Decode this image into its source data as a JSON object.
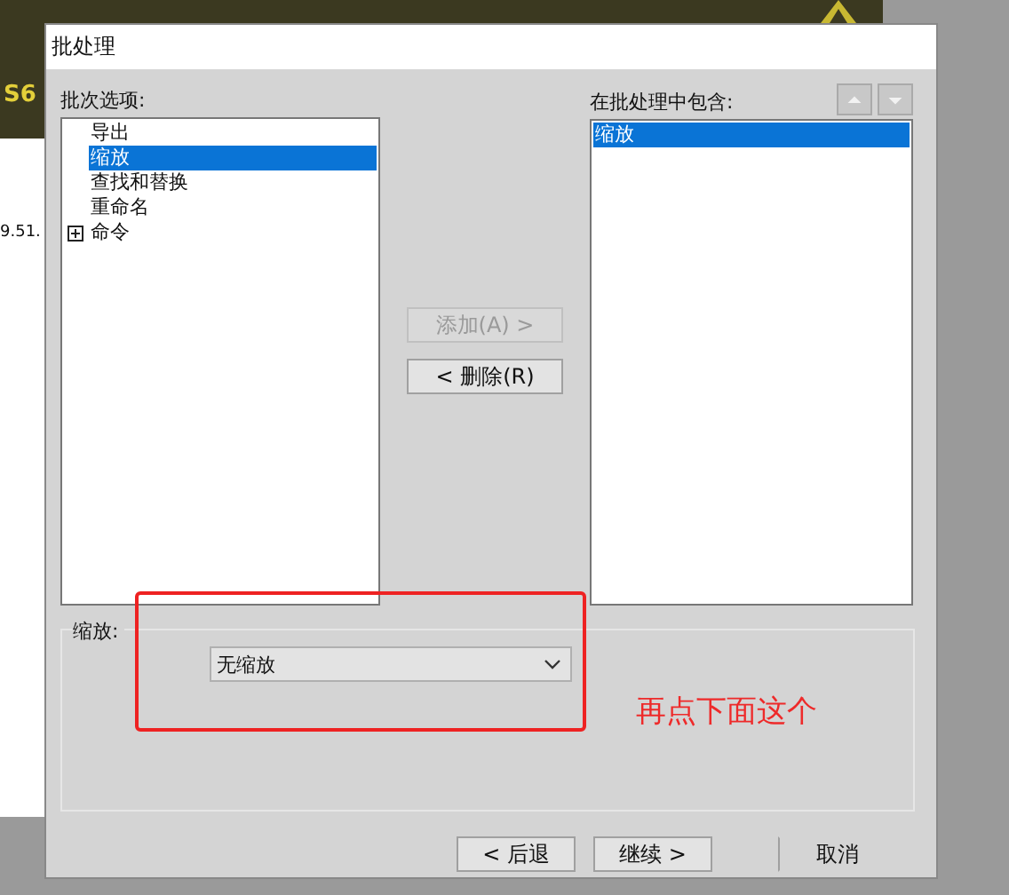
{
  "background_app": {
    "logo_text": "S6",
    "texts": [
      "9.51."
    ]
  },
  "window": {
    "title": "批处理"
  },
  "options": {
    "label": "批次选项:",
    "items": [
      {
        "label": "导出",
        "selected": false,
        "expandable": false
      },
      {
        "label": "缩放",
        "selected": true,
        "expandable": false
      },
      {
        "label": "查找和替换",
        "selected": false,
        "expandable": false
      },
      {
        "label": "重命名",
        "selected": false,
        "expandable": false
      },
      {
        "label": "命令",
        "selected": false,
        "expandable": true
      }
    ]
  },
  "middle_buttons": [
    {
      "label": "添加(A) >",
      "disabled": true
    },
    {
      "label": "< 删除(R)",
      "disabled": false
    }
  ],
  "included": {
    "label": "在批处理中包含:",
    "items": [
      {
        "label": "缩放",
        "selected": true
      }
    ]
  },
  "settings": {
    "label": "缩放:",
    "dropdown_value": "无缩放"
  },
  "footer_buttons": [
    {
      "label": "< 后退",
      "bordered": true
    },
    {
      "label": "继续 >",
      "bordered": true
    },
    {
      "label": "取消",
      "bordered": false
    }
  ],
  "annotation": {
    "text": "再点下面这个"
  }
}
